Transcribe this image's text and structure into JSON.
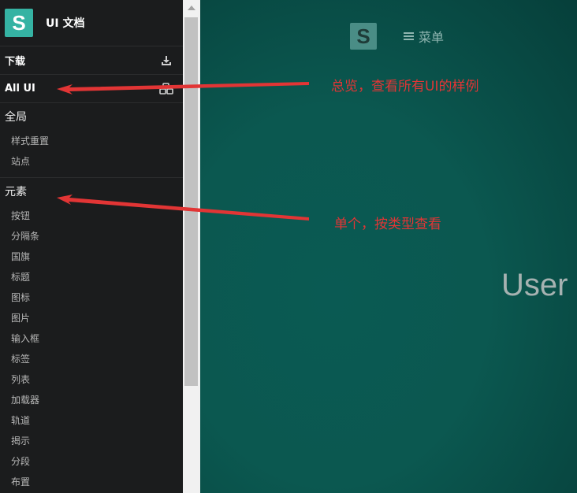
{
  "sidebar": {
    "brand_logo": "S",
    "brand_title": "UI 文档",
    "download_label": "下载",
    "download_icon": "download-icon",
    "allui_label": "All UI",
    "allui_icon": "cubes-icon",
    "global": {
      "title": "全局",
      "items": [
        "样式重置",
        "站点"
      ]
    },
    "elements": {
      "title": "元素",
      "items": [
        "按钮",
        "分隔条",
        "国旗",
        "标题",
        "图标",
        "图片",
        "输入框",
        "标签",
        "列表",
        "加载器",
        "轨道",
        "揭示",
        "分段",
        "布置"
      ]
    }
  },
  "header": {
    "logo": "S",
    "menu_label": "菜单"
  },
  "main": {
    "hero_text": "User"
  },
  "annotations": {
    "overview": "总览，查看所有UI的样例",
    "single": "单个，按类型查看"
  },
  "colors": {
    "sidebar_bg": "#1b1c1d",
    "brand_accent": "#35b3a3",
    "main_bg": "#0b5a52",
    "annotation": "#e23535"
  }
}
